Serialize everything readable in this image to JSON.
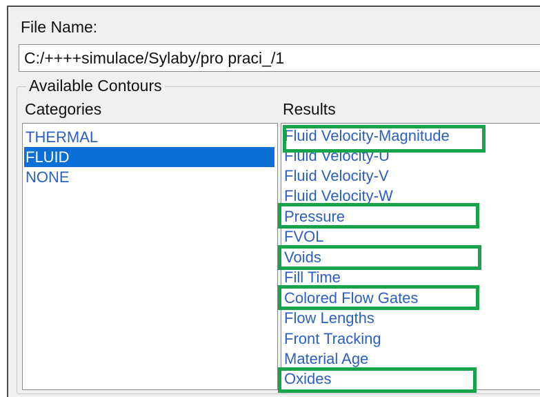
{
  "file": {
    "label": "File Name:",
    "value": "C:/++++simulace/Sylaby/pro praci_/1"
  },
  "contours": {
    "group_label": "Available Contours",
    "categories_label": "Categories",
    "results_label": "Results",
    "categories": [
      {
        "label": "THERMAL",
        "selected": false
      },
      {
        "label": "FLUID",
        "selected": true
      },
      {
        "label": "NONE",
        "selected": false
      }
    ],
    "results": [
      {
        "label": "Fluid Velocity-Magnitude",
        "highlighted": true
      },
      {
        "label": "Fluid Velocity-U",
        "highlighted": false
      },
      {
        "label": "Fluid Velocity-V",
        "highlighted": false
      },
      {
        "label": "Fluid Velocity-W",
        "highlighted": false
      },
      {
        "label": "Pressure",
        "highlighted": true
      },
      {
        "label": "FVOL",
        "highlighted": false
      },
      {
        "label": "Voids",
        "highlighted": true
      },
      {
        "label": "Fill Time",
        "highlighted": false
      },
      {
        "label": "Colored Flow Gates",
        "highlighted": true
      },
      {
        "label": "Flow Lengths",
        "highlighted": false
      },
      {
        "label": "Front Tracking",
        "highlighted": false
      },
      {
        "label": "Material Age",
        "highlighted": false
      },
      {
        "label": "Oxides",
        "highlighted": true
      }
    ]
  },
  "colors": {
    "item_text": "#2b5fc2",
    "selection": "#0a6fd6",
    "annotation_box": "#16a34a"
  }
}
